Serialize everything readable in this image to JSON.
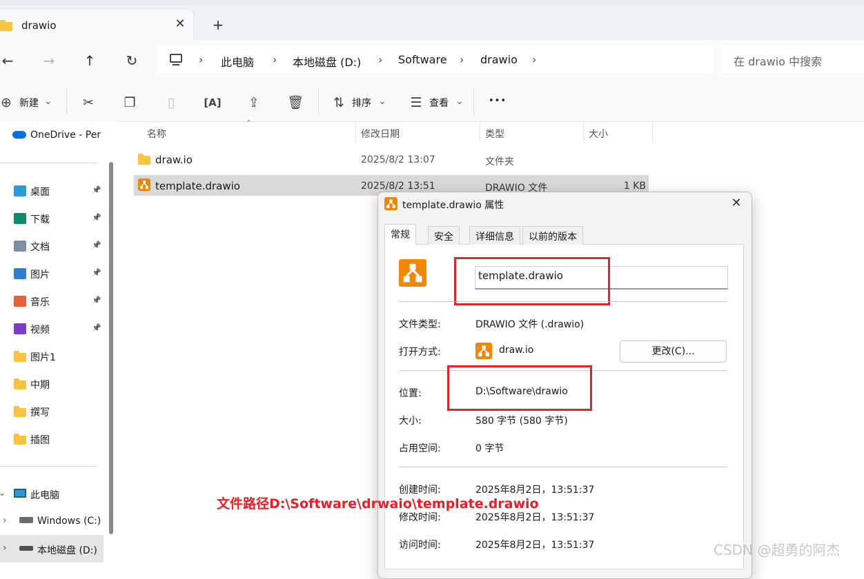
{
  "tab": {
    "title": "drawio",
    "close": "✕",
    "new": "+"
  },
  "nav": {
    "back": "←",
    "forward": "→",
    "up": "↑",
    "refresh": "↻"
  },
  "breadcrumb": {
    "chevron": "›",
    "items": [
      "此电脑",
      "本地磁盘 (D:)",
      "Software",
      "drawio"
    ]
  },
  "search": {
    "placeholder": "在 drawio 中搜索"
  },
  "toolbar": {
    "new_label": "新建",
    "sort_label": "排序",
    "view_label": "查看",
    "more": "•••",
    "dropdown": "⌄"
  },
  "sidebar": {
    "onedrive": "OneDrive - Per",
    "quick_access": [
      {
        "label": "桌面",
        "icon": "desktop-icon",
        "color": "#2b9bd8"
      },
      {
        "label": "下载",
        "icon": "download-icon",
        "color": "#0f8a6a"
      },
      {
        "label": "文档",
        "icon": "documents-icon",
        "color": "#7b8ea3"
      },
      {
        "label": "图片",
        "icon": "pictures-icon",
        "color": "#2f7fd1"
      },
      {
        "label": "音乐",
        "icon": "music-icon",
        "color": "#e5623c"
      },
      {
        "label": "视频",
        "icon": "videos-icon",
        "color": "#7b3fc4"
      }
    ],
    "folders": [
      "图片1",
      "中期",
      "撰写",
      "插图"
    ],
    "this_pc": "此电脑",
    "drives": [
      "Windows (C:)",
      "本地磁盘 (D:)"
    ]
  },
  "columns": {
    "name": "名称",
    "modified": "修改日期",
    "type": "类型",
    "size": "大小"
  },
  "files": [
    {
      "name": "draw.io",
      "modified": "2025/8/2 13:07",
      "type": "文件夹",
      "size": ""
    },
    {
      "name": "template.drawio",
      "modified": "2025/8/2 13:51",
      "type": "DRAWIO 文件",
      "size": "1 KB"
    }
  ],
  "dialog": {
    "title": "template.drawio 属性",
    "close": "✕",
    "tabs": [
      "常规",
      "安全",
      "详细信息",
      "以前的版本"
    ],
    "filename": "template.drawio",
    "file_type_label": "文件类型:",
    "file_type": "DRAWIO 文件 (.drawio)",
    "open_with_label": "打开方式:",
    "open_with": "draw.io",
    "change_button": "更改(C)...",
    "location_label": "位置:",
    "location": "D:\\Software\\drawio",
    "size_label": "大小:",
    "size": "580 字节 (580 字节)",
    "size_on_disk_label": "占用空间:",
    "size_on_disk": "0 字节",
    "created_label": "创建时间:",
    "created": "2025年8月2日，13:51:37",
    "modified_label": "修改时间:",
    "modified": "2025年8月2日，13:51:37",
    "accessed_label": "访问时间:",
    "accessed": "2025年8月2日，13:51:37"
  },
  "annotation": "文件路径D:\\Software\\drwaio\\template.drawio",
  "watermark": "CSDN @超勇的阿杰",
  "colors": {
    "accent_red": "#e0242d",
    "drawio_orange": "#f08705",
    "folder_yellow": "#f6c343"
  }
}
